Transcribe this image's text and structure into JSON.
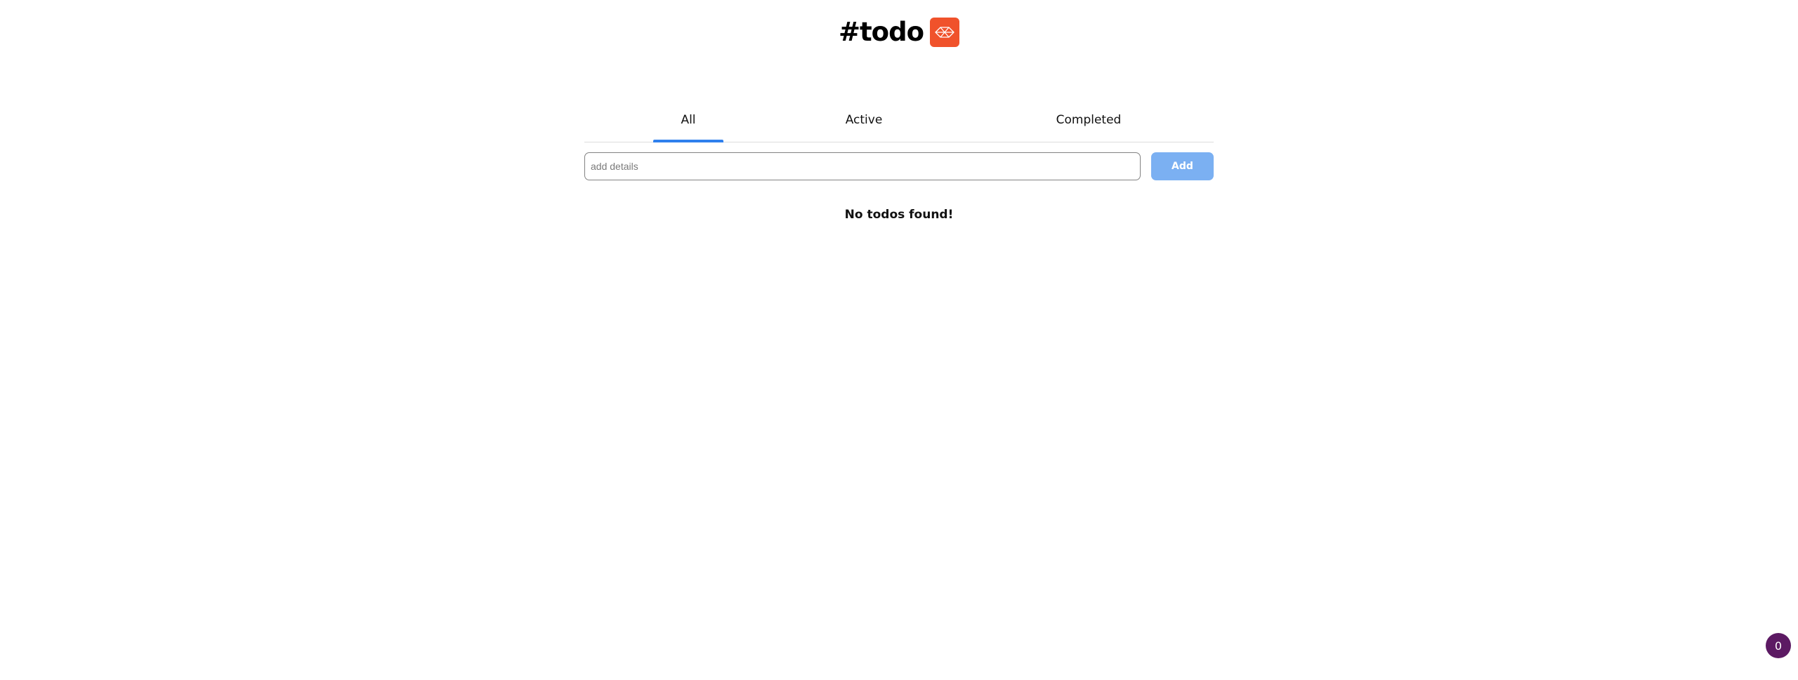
{
  "header": {
    "title": "#todo",
    "logo_icon": "origami-box-icon"
  },
  "tabs": [
    {
      "label": "All",
      "selected": true
    },
    {
      "label": "Active",
      "selected": false
    },
    {
      "label": "Completed",
      "selected": false
    }
  ],
  "form": {
    "input_value": "",
    "input_placeholder": "add details",
    "add_label": "Add"
  },
  "empty_message": "No todos found!",
  "badge": {
    "count": "0"
  },
  "colors": {
    "logo_bg": "#f0522b",
    "tab_indicator": "#2f80ed",
    "add_button_bg": "#7bb0f2",
    "badge_bg": "#5c1a63",
    "input_border": "#828282",
    "divider": "#dcdcdc"
  }
}
